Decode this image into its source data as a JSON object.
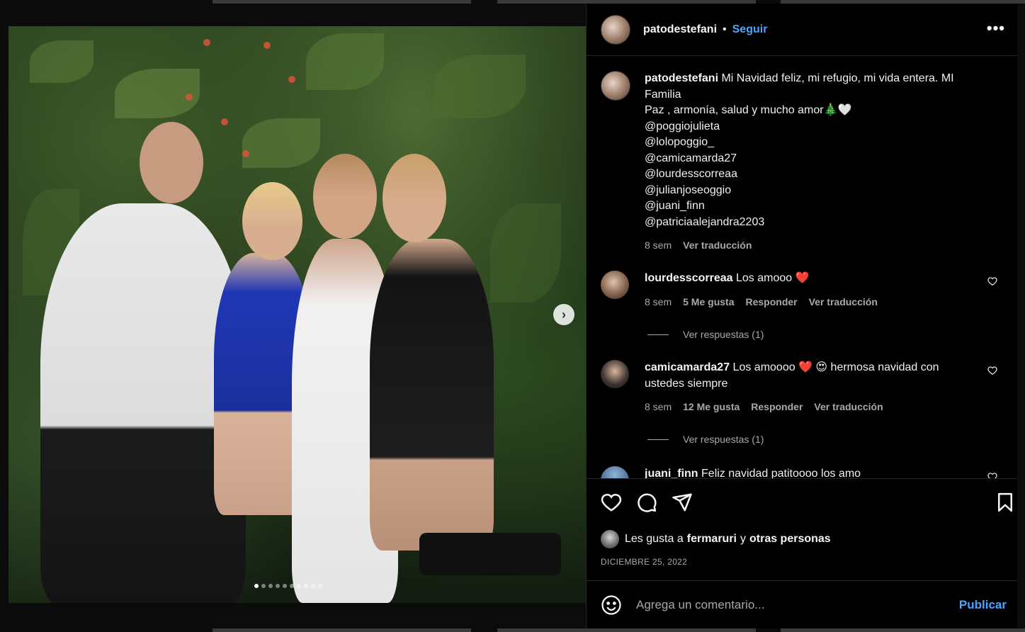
{
  "post": {
    "author": "patodestefani",
    "separator": "•",
    "follow_label": "Seguir",
    "more_label": "•••",
    "caption_user": "patodestefani",
    "caption_lines": [
      "Mi Navidad feliz, mi refugio, mi vida entera. MI",
      "Familia",
      "Paz , armonía, salud y mucho amor🎄🤍",
      "@poggiojulieta",
      "@lolopoggio_",
      "@camicamarda27",
      "@lourdesscorreaa",
      "@julianjoseoggio",
      "@juani_finn",
      "@patriciaalejandra2203"
    ],
    "caption_time": "8 sem",
    "caption_translate": "Ver traducción",
    "carousel_dots": 10,
    "carousel_active": 0,
    "next_label": "›"
  },
  "comments": [
    {
      "user": "lourdesscorreaa",
      "text": "Los amooo",
      "emoji": "❤️",
      "time": "8 sem",
      "likes": "5 Me gusta",
      "reply": "Responder",
      "translate": "Ver traducción",
      "replies": "Ver respuestas (1)"
    },
    {
      "user": "camicamarda27",
      "text": "Los amoooo ❤️ 😍 hermosa navidad con",
      "text2": "ustedes siempre",
      "time": "8 sem",
      "likes": "12 Me gusta",
      "reply": "Responder",
      "translate": "Ver traducción",
      "replies": "Ver respuestas (1)"
    },
    {
      "user": "juani_finn",
      "text": "Feliz navidad patitoooo los amo"
    }
  ],
  "footer": {
    "likes_prefix": "Les gusta a",
    "likes_user": "fermaruri",
    "likes_mid": "y",
    "likes_suffix": "otras personas",
    "date": "DICIEMBRE 25, 2022",
    "comment_placeholder": "Agrega un comentario...",
    "publish_label": "Publicar"
  },
  "icons": {
    "like": "heart-icon",
    "comment": "comment-bubble-icon",
    "share": "paper-plane-icon",
    "save": "bookmark-icon",
    "emoji": "smiley-icon",
    "next": "chevron-right-icon"
  },
  "colors": {
    "accent": "#4da3ff",
    "background": "#000000",
    "muted": "#a8a8a8",
    "heart_red": "#ed2d4e"
  }
}
